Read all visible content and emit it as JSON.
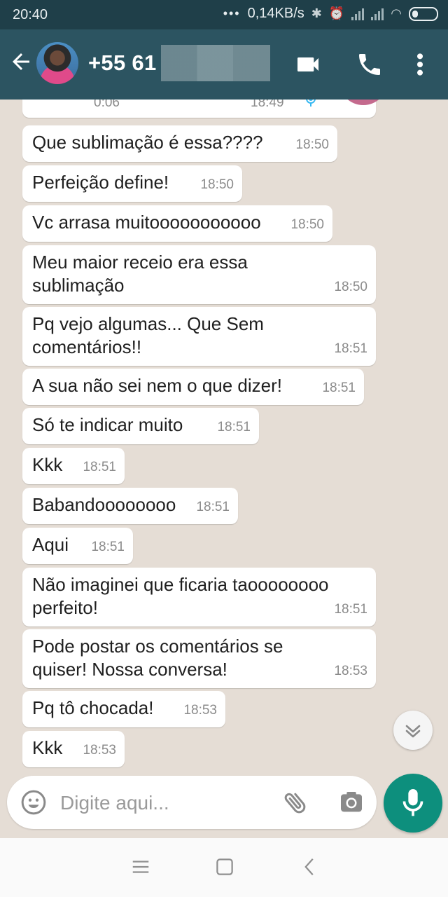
{
  "status_bar": {
    "time": "20:40",
    "dots": "•••",
    "speed": "0,14KB/s"
  },
  "header": {
    "contact_name": "+55 61"
  },
  "audio_message": {
    "duration": "0:06",
    "time": "18:49"
  },
  "messages": [
    {
      "lines": [
        "Que sublimação é essa????"
      ],
      "time": "18:50"
    },
    {
      "lines": [
        "Perfeição define!"
      ],
      "time": "18:50"
    },
    {
      "lines": [
        "Vc arrasa muitooooooooooo"
      ],
      "time": "18:50"
    },
    {
      "lines": [
        "Meu maior receio era essa",
        "sublimação"
      ],
      "time": "18:50"
    },
    {
      "lines": [
        "Pq vejo algumas... Que Sem",
        "comentários!!"
      ],
      "time": "18:51"
    },
    {
      "lines": [
        "A sua não sei nem o que dizer!"
      ],
      "time": "18:51"
    },
    {
      "lines": [
        "Só te indicar muito"
      ],
      "time": "18:51"
    },
    {
      "lines": [
        "Kkk"
      ],
      "time": "18:51"
    },
    {
      "lines": [
        "Babandoooooooo"
      ],
      "time": "18:51"
    },
    {
      "lines": [
        "Aqui"
      ],
      "time": "18:51"
    },
    {
      "lines": [
        "Não imaginei que ficaria taoooooooo",
        "perfeito!"
      ],
      "time": "18:51"
    },
    {
      "lines": [
        "Pode postar os comentários se",
        "quiser! Nossa conversa!"
      ],
      "time": "18:53"
    },
    {
      "lines": [
        "Pq tô chocada!"
      ],
      "time": "18:53"
    },
    {
      "lines": [
        "Kkk"
      ],
      "time": "18:53"
    }
  ],
  "composer": {
    "placeholder": "Digite aqui...",
    "value": ""
  },
  "colors": {
    "header": "#2c5461",
    "status_bar": "#1f3f49",
    "chat_background": "#e5ddd5",
    "bubble": "#ffffff",
    "accent": "#0d8f7d"
  },
  "icons": {
    "back": "arrow-left-icon",
    "video": "video-camera-icon",
    "call": "phone-icon",
    "menu": "more-vertical-icon",
    "emoji": "smiley-icon",
    "attach": "paperclip-icon",
    "camera": "camera-icon",
    "mic": "microphone-icon",
    "scroll": "chevrons-down-icon"
  }
}
